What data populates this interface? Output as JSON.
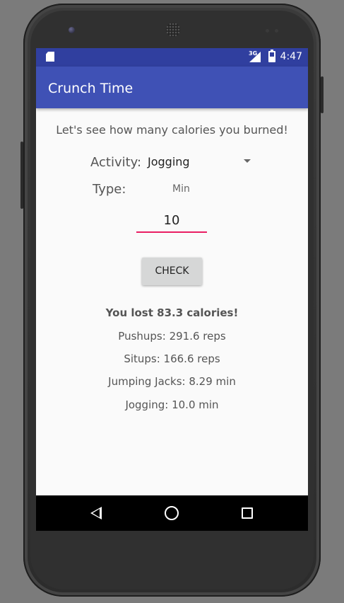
{
  "status_bar": {
    "network_type": "3G",
    "time": "4:47",
    "icons": [
      "sd-card-icon",
      "signal-icon",
      "battery-icon"
    ]
  },
  "app_bar": {
    "title": "Crunch Time"
  },
  "main": {
    "intro": "Let's see how many calories you burned!",
    "activity_label": "Activity:",
    "activity_value": "Jogging",
    "type_label": "Type:",
    "unit": "Min",
    "minutes_value": "10",
    "check_button": "CHECK",
    "results": {
      "headline": "You lost 83.3 calories!",
      "pushups": "Pushups: 291.6 reps",
      "situps": "Situps: 166.6 reps",
      "jumping_jacks": "Jumping Jacks: 8.29 min",
      "jogging": "Jogging: 10.0 min"
    }
  },
  "nav_bar": {
    "icons": [
      "back-icon",
      "home-icon",
      "recents-icon"
    ]
  },
  "colors": {
    "status_bar": "#303f9f",
    "app_bar": "#3f51b5",
    "input_underline": "#e91e63",
    "button": "#d6d7d7",
    "background": "#fafafa"
  }
}
